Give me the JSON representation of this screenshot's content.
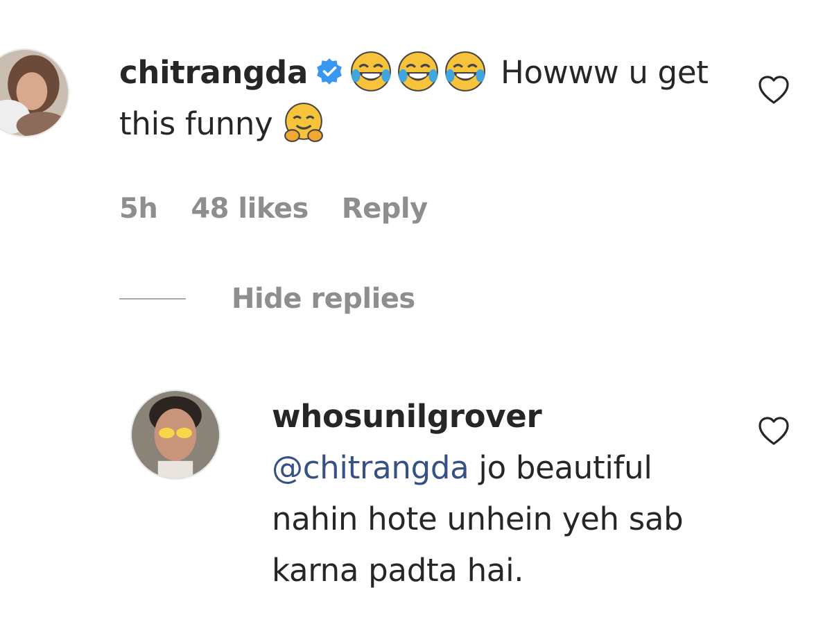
{
  "comment": {
    "username": "chitrangda",
    "verified": true,
    "emojis_before": [
      "face-with-tears-of-joy-icon",
      "face-with-tears-of-joy-icon",
      "face-with-tears-of-joy-icon"
    ],
    "text_part1": " Howww u get this funny ",
    "emoji_after": "hugging-face-icon",
    "time": "5h",
    "likes": "48 likes",
    "reply_label": "Reply"
  },
  "replies_toggle": {
    "label": "Hide replies"
  },
  "reply": {
    "username": "whosunilgrover",
    "mention": "@chitrangda",
    "text": " jo beautiful nahin hote unhein yeh sab karna padta hai."
  },
  "colors": {
    "text": "#262626",
    "meta": "#8e8e8e",
    "mention": "#385185",
    "verified": "#3897f0",
    "emoji_yellow": "#f7c33b"
  }
}
